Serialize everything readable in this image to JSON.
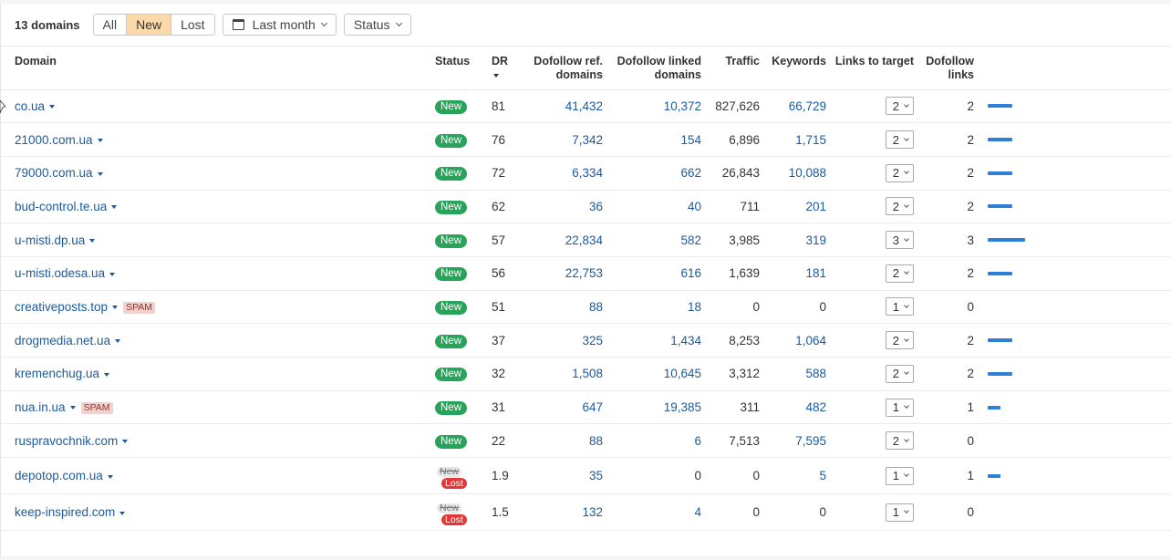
{
  "toolbar": {
    "count_label": "13 domains",
    "filters": [
      "All",
      "New",
      "Lost"
    ],
    "active_filter": "New",
    "date_label": "Last month",
    "status_label": "Status"
  },
  "columns": {
    "domain": "Domain",
    "status": "Status",
    "dr": "DR",
    "ref_1": "Dofollow ref.",
    "ref_2": "domains",
    "linked_1": "Dofollow linked",
    "linked_2": "domains",
    "traffic": "Traffic",
    "keywords": "Keywords",
    "ltt": "Links to target",
    "dl_1": "Dofollow",
    "dl_2": "links"
  },
  "status_labels": {
    "new": "New",
    "lost": "Lost"
  },
  "spam_label": "SPAM",
  "colors": {
    "new": "#27a35a",
    "lost": "#e0383b",
    "link": "#1a5a9e",
    "bar": "#2f7fd6",
    "active_filter": "#fcd9a8"
  },
  "rows": [
    {
      "domain": "co.ua",
      "spam": false,
      "status": "new",
      "dr": "81",
      "ref": "41,432",
      "linked": "10,372",
      "traffic": "827,626",
      "keywords": "66,729",
      "ltt": "2",
      "dl": "2"
    },
    {
      "domain": "21000.com.ua",
      "spam": false,
      "status": "new",
      "dr": "76",
      "ref": "7,342",
      "linked": "154",
      "traffic": "6,896",
      "keywords": "1,715",
      "ltt": "2",
      "dl": "2"
    },
    {
      "domain": "79000.com.ua",
      "spam": false,
      "status": "new",
      "dr": "72",
      "ref": "6,334",
      "linked": "662",
      "traffic": "26,843",
      "keywords": "10,088",
      "ltt": "2",
      "dl": "2"
    },
    {
      "domain": "bud-control.te.ua",
      "spam": false,
      "status": "new",
      "dr": "62",
      "ref": "36",
      "linked": "40",
      "traffic": "711",
      "keywords": "201",
      "ltt": "2",
      "dl": "2"
    },
    {
      "domain": "u-misti.dp.ua",
      "spam": false,
      "status": "new",
      "dr": "57",
      "ref": "22,834",
      "linked": "582",
      "traffic": "3,985",
      "keywords": "319",
      "ltt": "3",
      "dl": "3"
    },
    {
      "domain": "u-misti.odesa.ua",
      "spam": false,
      "status": "new",
      "dr": "56",
      "ref": "22,753",
      "linked": "616",
      "traffic": "1,639",
      "keywords": "181",
      "ltt": "2",
      "dl": "2"
    },
    {
      "domain": "creativeposts.top",
      "spam": true,
      "status": "new",
      "dr": "51",
      "ref": "88",
      "linked": "18",
      "traffic": "0",
      "keywords": "0",
      "ltt": "1",
      "dl": "0"
    },
    {
      "domain": "drogmedia.net.ua",
      "spam": false,
      "status": "new",
      "dr": "37",
      "ref": "325",
      "linked": "1,434",
      "traffic": "8,253",
      "keywords": "1,064",
      "ltt": "2",
      "dl": "2"
    },
    {
      "domain": "kremenchug.ua",
      "spam": false,
      "status": "new",
      "dr": "32",
      "ref": "1,508",
      "linked": "10,645",
      "traffic": "3,312",
      "keywords": "588",
      "ltt": "2",
      "dl": "2"
    },
    {
      "domain": "nua.in.ua",
      "spam": true,
      "status": "new",
      "dr": "31",
      "ref": "647",
      "linked": "19,385",
      "traffic": "311",
      "keywords": "482",
      "ltt": "1",
      "dl": "1"
    },
    {
      "domain": "ruspravochnik.com",
      "spam": false,
      "status": "new",
      "dr": "22",
      "ref": "88",
      "linked": "6",
      "traffic": "7,513",
      "keywords": "7,595",
      "ltt": "2",
      "dl": "0"
    },
    {
      "domain": "depotop.com.ua",
      "spam": false,
      "status": "lost",
      "dr": "1.9",
      "ref": "35",
      "linked": "0",
      "traffic": "0",
      "keywords": "5",
      "ltt": "1",
      "dl": "1"
    },
    {
      "domain": "keep-inspired.com",
      "spam": false,
      "status": "lost",
      "dr": "1.5",
      "ref": "132",
      "linked": "4",
      "traffic": "0",
      "keywords": "0",
      "ltt": "1",
      "dl": "0"
    }
  ]
}
